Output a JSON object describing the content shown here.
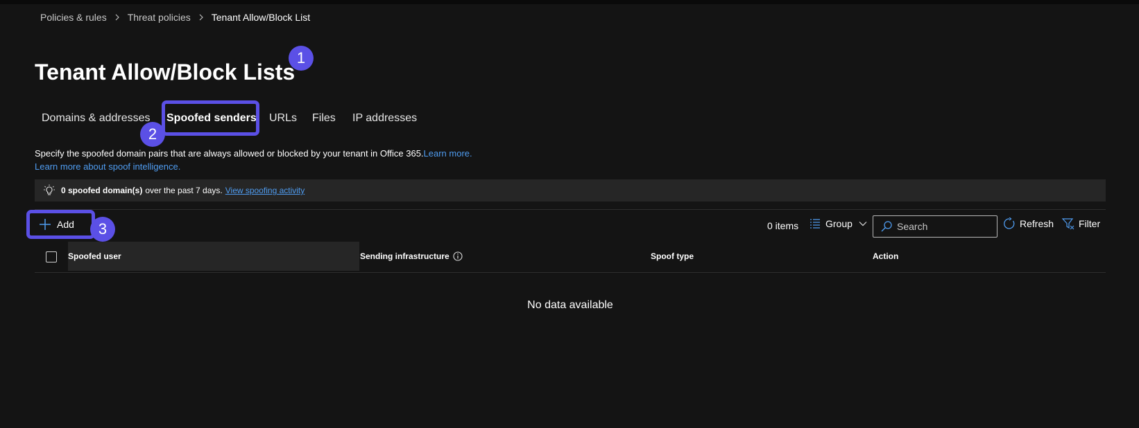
{
  "breadcrumb": {
    "items": [
      "Policies & rules",
      "Threat policies",
      "Tenant Allow/Block List"
    ]
  },
  "page": {
    "title": "Tenant Allow/Block Lists"
  },
  "tabs": [
    {
      "label": "Domains & addresses",
      "active": false
    },
    {
      "label": "Spoofed senders",
      "active": true
    },
    {
      "label": "URLs",
      "active": false
    },
    {
      "label": "Files",
      "active": false
    },
    {
      "label": "IP addresses",
      "active": false
    }
  ],
  "description": {
    "text": "Specify the spoofed domain pairs that are always allowed or blocked by your tenant in Office 365.",
    "learn_more": "Learn more.",
    "spoof_link": "Learn more about spoof intelligence."
  },
  "infobar": {
    "icon": "lightbulb-icon",
    "bold_text": "0 spoofed domain(s)",
    "text": "over the past 7 days.",
    "link": "View spoofing activity"
  },
  "toolbar": {
    "add_label": "Add",
    "items_count": "0 items",
    "group_label": "Group",
    "search_placeholder": "Search",
    "refresh_label": "Refresh",
    "filter_label": "Filter"
  },
  "table": {
    "columns": [
      "Spoofed user",
      "Sending infrastructure",
      "Spoof type",
      "Action"
    ],
    "empty_message": "No data available"
  },
  "annotations": {
    "markers": [
      "1",
      "2",
      "3"
    ]
  },
  "colors": {
    "background": "#141414",
    "accent": "#5b50e6",
    "link": "#4f9cf0",
    "infobar": "#262626"
  }
}
